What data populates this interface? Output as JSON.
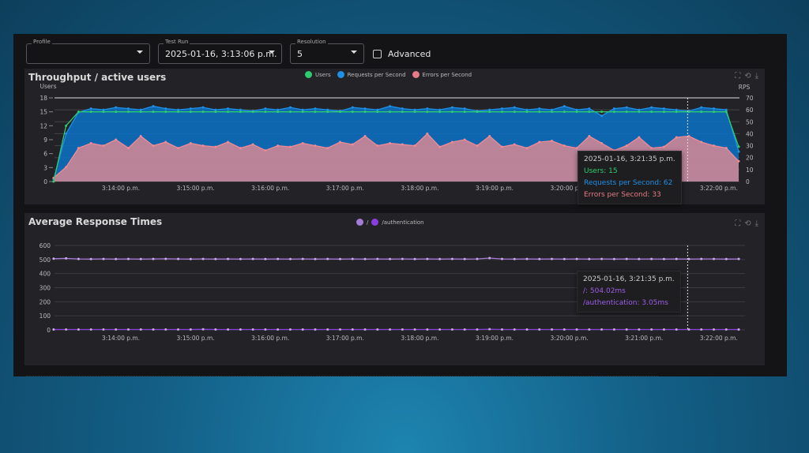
{
  "controls": {
    "profile": {
      "label": "Profile",
      "value": ""
    },
    "test_run": {
      "label": "Test Run",
      "value": "2025-01-16, 3:13:06 p.m."
    },
    "resolution": {
      "label": "Resolution",
      "value": "5"
    },
    "advanced": "Advanced"
  },
  "charts": {
    "throughput": {
      "title": "Throughput / active users",
      "legend": [
        "Users",
        "Requests per Second",
        "Errors per Second"
      ],
      "colors": {
        "users": "#2ecc71",
        "rps": "#1e90e6",
        "errors": "#e57b86"
      },
      "tooltip": {
        "time": "2025-01-16, 3:21:35 p.m.",
        "users": "Users: 15",
        "rps": "Requests per Second: 62",
        "errors": "Errors per Second: 33"
      }
    },
    "response": {
      "title": "Average Response Times",
      "legend": [
        "/",
        "/authentication"
      ],
      "colors": [
        "#a57bd8",
        "#8a3ee0"
      ],
      "tooltip": {
        "time": "2025-01-16, 3:21:35 p.m.",
        "root": "/: 504.02ms",
        "auth": "/authentication: 3.05ms"
      }
    }
  },
  "chart_data": [
    {
      "type": "line",
      "title": "Throughput / active users",
      "ylabel": "Users",
      "y2label": "RPS",
      "ylim": [
        0,
        18
      ],
      "y2lim": [
        0,
        70
      ],
      "yticks": [
        0,
        3,
        6,
        9,
        12,
        15,
        18
      ],
      "y2ticks": [
        0,
        10,
        20,
        30,
        40,
        50,
        60,
        70
      ],
      "x_start_sec": 6,
      "x_step_sec": 10,
      "xticks": [
        "3:14:00 p.m.",
        "3:15:00 p.m.",
        "3:16:00 p.m.",
        "3:17:00 p.m.",
        "3:18:00 p.m.",
        "3:19:00 p.m.",
        "3:20:00 p.m.",
        "3:21:00 p.m.",
        "3:22:00 p.m."
      ],
      "series": [
        {
          "name": "Users",
          "axis": "left",
          "values": [
            0,
            12,
            15,
            15,
            15,
            15,
            15,
            15,
            15,
            15,
            15,
            15,
            15,
            15,
            15,
            15,
            15,
            15,
            15,
            15,
            15,
            15,
            15,
            15,
            15,
            15,
            15,
            15,
            15,
            15,
            15,
            15,
            15,
            15,
            15,
            15,
            15,
            15,
            15,
            15,
            15,
            15,
            15,
            15,
            15,
            15,
            15,
            15,
            15,
            15,
            15,
            15,
            15,
            15,
            15,
            7.5
          ]
        },
        {
          "name": "Requests per Second",
          "axis": "right",
          "values": [
            2,
            40,
            58,
            61,
            60,
            62,
            61,
            60,
            63,
            61,
            60,
            61,
            62,
            60,
            61,
            60,
            59,
            61,
            60,
            62,
            60,
            61,
            60,
            59,
            62,
            61,
            60,
            63,
            61,
            60,
            61,
            60,
            62,
            61,
            59,
            60,
            61,
            62,
            60,
            61,
            60,
            63,
            60,
            61,
            55,
            61,
            62,
            60,
            62,
            61,
            60,
            59,
            62,
            61,
            60,
            25
          ]
        },
        {
          "name": "Errors per Second",
          "axis": "right",
          "values": [
            3,
            12,
            28,
            32,
            30,
            35,
            28,
            38,
            30,
            33,
            28,
            32,
            30,
            29,
            33,
            28,
            31,
            26,
            30,
            29,
            32,
            30,
            28,
            33,
            31,
            38,
            30,
            32,
            31,
            30,
            40,
            29,
            33,
            35,
            30,
            38,
            29,
            31,
            28,
            33,
            34,
            30,
            28,
            38,
            32,
            26,
            30,
            37,
            28,
            29,
            37,
            38,
            33,
            30,
            28,
            17
          ]
        }
      ]
    },
    {
      "type": "line",
      "title": "Average Response Times",
      "ylim": [
        0,
        600
      ],
      "yticks": [
        0,
        100,
        200,
        300,
        400,
        500,
        600
      ],
      "x_start_sec": 6,
      "x_step_sec": 10,
      "xticks": [
        "3:14:00 p.m.",
        "3:15:00 p.m.",
        "3:16:00 p.m.",
        "3:17:00 p.m.",
        "3:18:00 p.m.",
        "3:19:00 p.m.",
        "3:20:00 p.m.",
        "3:21:00 p.m.",
        "3:22:00 p.m."
      ],
      "series": [
        {
          "name": "/",
          "values": [
            506,
            508,
            504,
            503,
            504,
            503,
            504,
            503,
            504,
            505,
            504,
            503,
            504,
            503,
            504,
            503,
            504,
            503,
            504,
            503,
            504,
            503,
            504,
            503,
            504,
            503,
            504,
            503,
            504,
            503,
            504,
            503,
            504,
            503,
            504,
            510,
            504,
            503,
            504,
            503,
            504,
            503,
            504,
            503,
            504,
            503,
            504,
            503,
            504,
            503,
            504,
            503,
            504,
            504,
            503,
            504
          ]
        },
        {
          "name": "/authentication",
          "values": [
            3,
            3,
            3,
            3,
            3,
            3,
            3,
            3,
            3,
            3,
            3,
            3,
            4,
            3,
            3,
            3,
            3,
            3,
            3,
            3,
            3,
            3,
            3,
            3,
            3,
            3,
            3,
            3,
            3,
            3,
            3,
            3,
            3,
            3,
            3,
            5,
            3,
            3,
            3,
            3,
            3,
            3,
            3,
            3,
            3,
            3,
            3,
            3,
            3,
            3,
            3,
            3,
            3,
            3.05,
            3,
            3
          ]
        }
      ]
    }
  ]
}
